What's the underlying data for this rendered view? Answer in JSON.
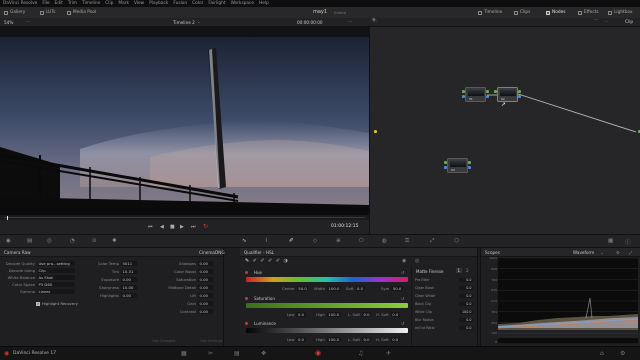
{
  "menu": [
    "DaVinci Resolve",
    "File",
    "Edit",
    "Trim",
    "Timeline",
    "Clip",
    "Mark",
    "View",
    "Playback",
    "Fusion",
    "Color",
    "Fairlight",
    "Workspace",
    "Help"
  ],
  "toolbar": {
    "left": [
      "Gallery",
      "LUTs",
      "Media Pool"
    ],
    "project_title": "may1",
    "project_status": "Edited",
    "right": [
      "Timeline",
      "Clips",
      "Nodes",
      "Effects",
      "Lightbox"
    ]
  },
  "viewer": {
    "zoom": "54%",
    "timeline_name": "Timeline 2",
    "timecode_top": "00:00:00:00",
    "timecode": "01:00:12:15"
  },
  "node_editor": {
    "mode": "Clip",
    "nodes": [
      "01",
      "02",
      "03"
    ]
  },
  "camera_raw": {
    "header": "Camera Raw",
    "format": "CinemaDNG",
    "left_fields": [
      {
        "label": "Decode Quality",
        "value": "Use pro...setting"
      },
      {
        "label": "Decode Using",
        "value": "Clip"
      },
      {
        "label": "White Balance",
        "value": "As Shot"
      },
      {
        "label": "Color Space",
        "value": "P3 D60"
      },
      {
        "label": "Gamma",
        "value": "Linear"
      }
    ],
    "mid_fields": [
      {
        "label": "Color Temp",
        "value": "5011"
      },
      {
        "label": "Tint",
        "value": "10.31"
      },
      {
        "label": "Exposure",
        "value": "0.00"
      },
      {
        "label": "Sharpness",
        "value": "10.00"
      },
      {
        "label": "Highlights",
        "value": "0.00"
      }
    ],
    "right_fields": [
      {
        "label": "Shadows",
        "value": "0.00"
      },
      {
        "label": "Color Boost",
        "value": "0.00"
      },
      {
        "label": "Saturation",
        "value": "0.00"
      },
      {
        "label": "Midtone Detail",
        "value": "0.00"
      },
      {
        "label": "Lift",
        "value": "0.00"
      },
      {
        "label": "Gain",
        "value": "0.00"
      },
      {
        "label": "Contrast",
        "value": "0.00"
      }
    ],
    "highlight_recovery": "Highlight Recovery",
    "use_changes": "Use Changes",
    "use_settings": "Use Settings"
  },
  "qualifier": {
    "header": "Qualifier - HSL",
    "hue": {
      "label": "Hue",
      "center_label": "Center",
      "center": "50.0",
      "width_label": "Width",
      "width": "100.0",
      "soft_label": "Soft",
      "soft": "0.0",
      "sym_label": "Sym",
      "sym": "50.0"
    },
    "saturation": {
      "label": "Saturation",
      "low_label": "Low",
      "low": "0.0",
      "high_label": "High",
      "high": "100.0",
      "lsoft_label": "L. Soft",
      "lsoft": "0.0",
      "hsoft_label": "H. Soft",
      "hsoft": "0.0"
    },
    "luminance": {
      "label": "Luminance",
      "low_label": "Low",
      "low": "0.0",
      "high_label": "High",
      "high": "100.0",
      "lsoft_label": "L. Soft",
      "lsoft": "0.0",
      "hsoft_label": "H. Soft",
      "hsoft": "0.0"
    },
    "matte": {
      "title": "Matte Finesse",
      "tabs": [
        "1",
        "2"
      ],
      "rows": [
        {
          "label": "Pre-Filter",
          "value": "0.0"
        },
        {
          "label": "Clean Black",
          "value": "0.0"
        },
        {
          "label": "Clean White",
          "value": "0.0"
        },
        {
          "label": "Black Clip",
          "value": "0.0"
        },
        {
          "label": "White Clip",
          "value": "100.0"
        },
        {
          "label": "Blur Radius",
          "value": "0.0"
        },
        {
          "label": "In/Out Ratio",
          "value": "0.0"
        }
      ]
    }
  },
  "scopes": {
    "header": "Scopes",
    "type": "Waveform",
    "ticks": [
      "1023",
      "896",
      "768",
      "640",
      "512",
      "384",
      "256",
      "128",
      "0"
    ]
  },
  "bottombar": {
    "app": "DaVinci Resolve 17"
  }
}
